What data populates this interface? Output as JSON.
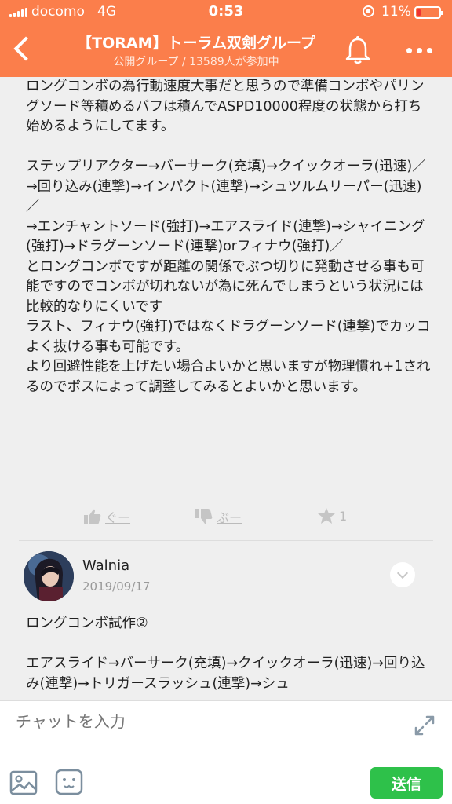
{
  "status_bar": {
    "carrier": "docomo",
    "network": "4G",
    "time": "0:53",
    "battery": "11%"
  },
  "header": {
    "title": "【TORAM】トーラム双剣グループ",
    "subtitle": "公開グループ / 13589人が参加中"
  },
  "posts": [
    {
      "text": "ロングコンボの為行動速度大事だと思うので準備コンボやパリングソード等積めるバフは積んでASPD10000程度の状態から打ち始めるようにしてます。\n\nステップリアクター→バーサーク(充填)→クイックオーラ(迅速)／\n→回り込み(連撃)→インパクト(連撃)→シュツルムリーパー(迅速)／\n→エンチャントソード(強打)→エアスライド(連撃)→シャイニング(強打)→ドラグーンソード(連撃)orフィナウ(強打)／\nとロングコンボですが距離の関係でぶつ切りに発動させる事も可能ですのでコンボが切れないが為に死んでしまうという状況には比較的なりにくいです\nラスト、フィナウ(強打)ではなくドラグーンソード(連撃)でカッコよく抜ける事も可能です。\nより回避性能を上げたい場合よいかと思いますが物理慣れ+1されるのでボスによって調整してみるとよいかと思います。",
      "reactions": {
        "good_label": "ぐー",
        "boo_label": "ぶー",
        "star_count": "1"
      }
    },
    {
      "username": "Walnia",
      "date": "2019/09/17",
      "text": "ロングコンボ試作②\n\nエアスライド→バーサーク(充填)→クイックオーラ(迅速)→回り込み(連撃)→トリガースラッシュ(連撃)→シュ"
    }
  ],
  "chat": {
    "placeholder": "チャットを入力",
    "send_label": "送信"
  },
  "colors": {
    "header_bg": "#fb7e4b",
    "send_bg": "#2ec14a",
    "body_bg": "#efefef"
  },
  "icons": [
    "back-arrow-icon",
    "bell-icon",
    "more-icon",
    "thumbs-up-icon",
    "thumbs-down-icon",
    "star-icon",
    "chevron-down-icon",
    "expand-icon",
    "image-icon",
    "emoji-icon"
  ]
}
